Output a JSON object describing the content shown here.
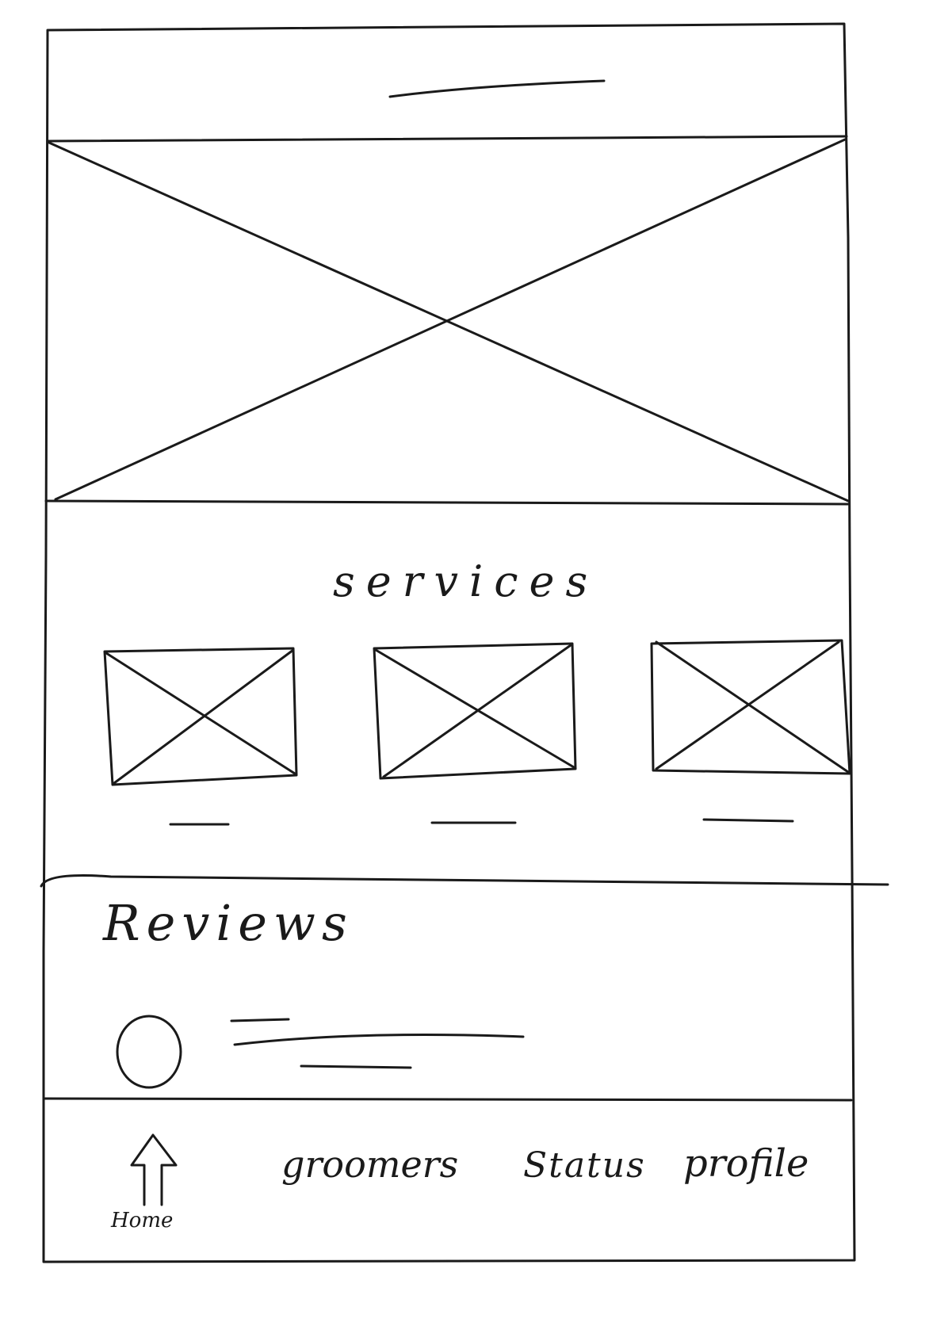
{
  "app": {
    "line_color": "#1a1a1a",
    "background": "#ffffff"
  },
  "header": {
    "title_placeholder": "title-line"
  },
  "hero": {
    "image_placeholder": "hero-image"
  },
  "services": {
    "title": "services",
    "cards": [
      {
        "image": "service-image-1",
        "caption_placeholder": "caption-line"
      },
      {
        "image": "service-image-2",
        "caption_placeholder": "caption-line"
      },
      {
        "image": "service-image-3",
        "caption_placeholder": "caption-line"
      }
    ]
  },
  "reviews": {
    "title": "Reviews",
    "items": [
      {
        "avatar": "avatar-circle",
        "text_placeholder": "review-text-lines"
      }
    ]
  },
  "bottom_nav": {
    "items": [
      {
        "label": "Home",
        "icon": "arrow-up-icon"
      },
      {
        "label": "groomers",
        "icon": ""
      },
      {
        "label": "Status",
        "icon": ""
      },
      {
        "label": "profile",
        "icon": ""
      }
    ]
  }
}
